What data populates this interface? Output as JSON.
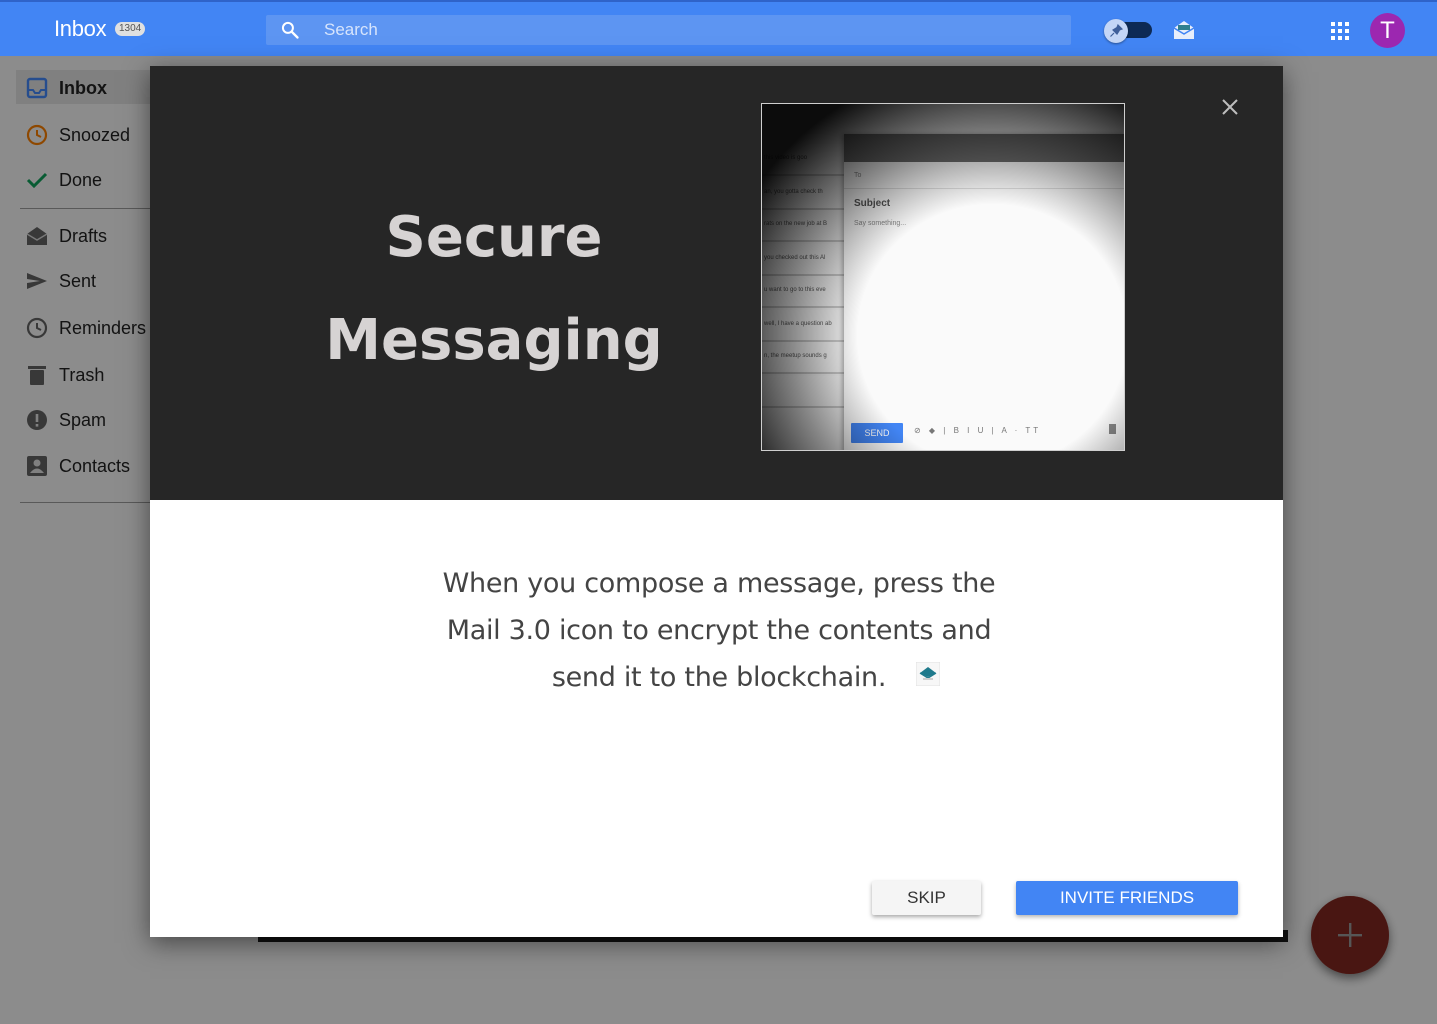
{
  "app": {
    "title": "Inbox",
    "unread_count": "1304"
  },
  "search": {
    "placeholder": "Search"
  },
  "user": {
    "initial": "T",
    "avatar_color": "#9c27b0"
  },
  "colors": {
    "topbar": "#4285f4",
    "primary_button": "#4285f4",
    "fab": "#db4437",
    "hero_bg": "#262626"
  },
  "sidebar": {
    "items": [
      {
        "label": "Inbox",
        "icon": "inbox-icon",
        "active": true
      },
      {
        "label": "Snoozed",
        "icon": "clock-icon"
      },
      {
        "label": "Done",
        "icon": "check-icon"
      },
      {
        "label": "Drafts",
        "icon": "drafts-icon"
      },
      {
        "label": "Sent",
        "icon": "send-icon"
      },
      {
        "label": "Reminders",
        "icon": "reminder-clock-icon"
      },
      {
        "label": "Trash",
        "icon": "trash-icon"
      },
      {
        "label": "Spam",
        "icon": "spam-icon"
      },
      {
        "label": "Contacts",
        "icon": "contacts-icon"
      }
    ]
  },
  "modal": {
    "title_line1": "Secure",
    "title_line2": "Messaging",
    "body_line1": "When you compose a message, press the",
    "body_line2": "Mail 3.0 icon to encrypt the contents and",
    "body_line3": "send it to the blockchain.",
    "skip_label": "SKIP",
    "invite_label": "INVITE FRIENDS",
    "preview": {
      "rows": [
        "this video is goo",
        "an, you gotta check th",
        "rats on the new job at B",
        "you checked out this Al",
        "u want to go to this eve",
        "well, I have a question ab",
        "n, the meetup sounds g"
      ],
      "to_label": "To",
      "subject_label": "Subject",
      "body_placeholder": "Say something...",
      "send_label": "SEND"
    }
  }
}
